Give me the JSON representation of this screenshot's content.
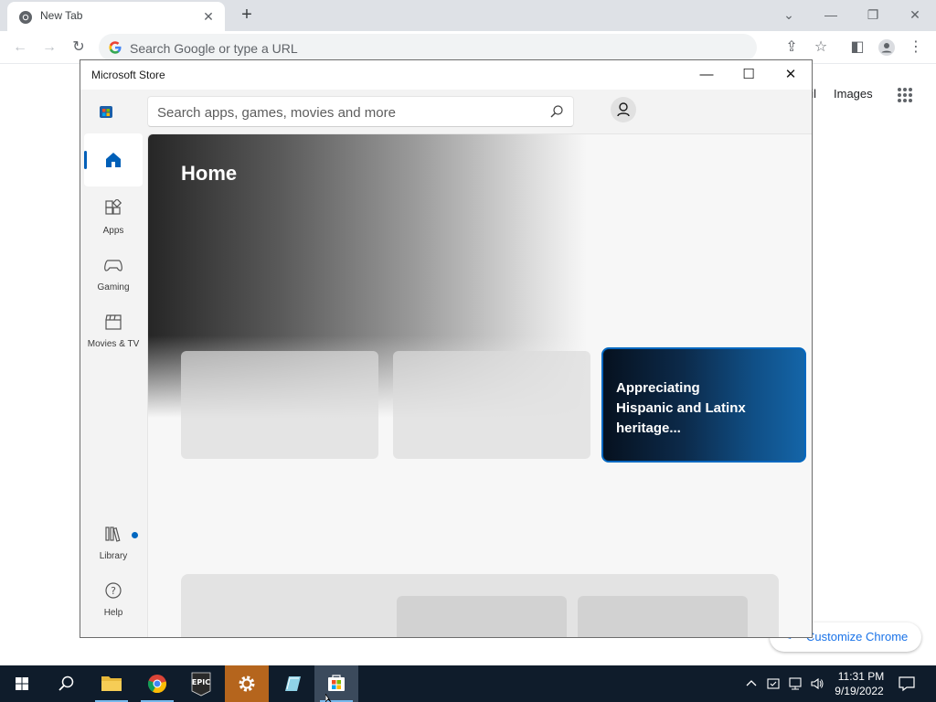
{
  "browser": {
    "tab_title": "New Tab",
    "omnibox_placeholder": "Search Google or type a URL",
    "ntp_gmail": "ail",
    "ntp_images": "Images",
    "customize_label": "Customize Chrome"
  },
  "store": {
    "window_title": "Microsoft Store",
    "search_placeholder": "Search apps, games, movies and more",
    "nav": [
      {
        "label": "Home",
        "icon": "home-icon"
      },
      {
        "label": "Apps",
        "icon": "apps-icon"
      },
      {
        "label": "Gaming",
        "icon": "gamepad-icon"
      },
      {
        "label": "Movies & TV",
        "icon": "clapperboard-icon"
      },
      {
        "label": "Library",
        "icon": "library-icon"
      },
      {
        "label": "Help",
        "icon": "help-icon"
      }
    ],
    "home_title": "Home",
    "featured_card": "Appreciating Hispanic and Latinx heritage...",
    "accent_color": "#0067c0"
  },
  "taskbar": {
    "apps": [
      "start",
      "search",
      "file-explorer",
      "chrome",
      "epic-games",
      "settings",
      "notepad",
      "microsoft-store"
    ],
    "clock_time": "11:31 PM",
    "clock_date": "9/19/2022"
  }
}
